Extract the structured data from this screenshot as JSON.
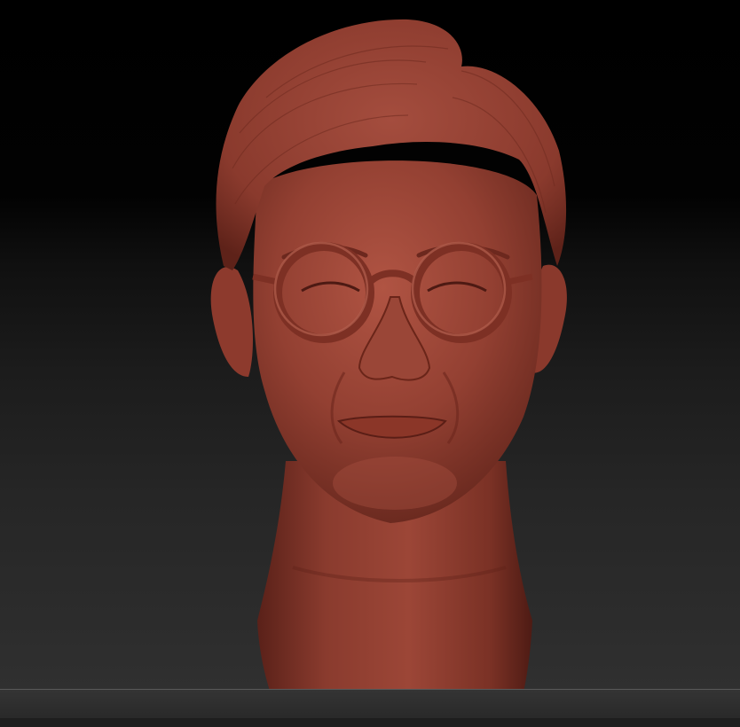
{
  "app": {
    "viewport_label": "",
    "model": {
      "icon": "sculpt-bust-icon",
      "material_color": "#8e3b2d",
      "highlight_color": "#b5584a",
      "shadow_color": "#4a1a12"
    },
    "background": {
      "top": "#000000",
      "bottom": "#303030"
    }
  }
}
